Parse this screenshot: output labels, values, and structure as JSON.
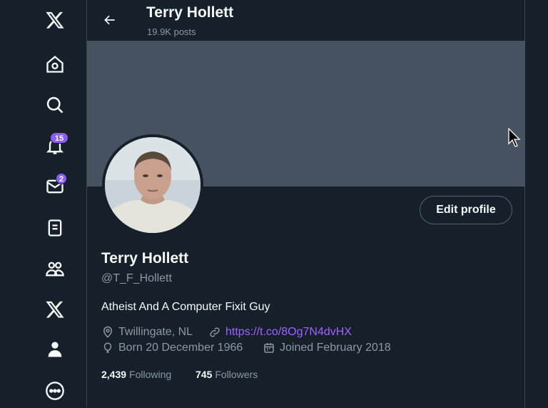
{
  "header": {
    "name": "Terry Hollett",
    "post_count": "19.9K posts"
  },
  "nav": {
    "notifications_badge": "15",
    "messages_badge": "2"
  },
  "profile": {
    "display_name": "Terry Hollett",
    "handle": "@T_F_Hollett",
    "bio": "Atheist And A Computer Fixit Guy",
    "location": "Twillingate, NL",
    "link": "https://t.co/8Og7N4dvHX",
    "birthday": "Born 20 December 1966",
    "joined": "Joined February 2018",
    "edit_label": "Edit profile",
    "following_count": "2,439",
    "following_label": "Following",
    "followers_count": "745",
    "followers_label": "Followers"
  },
  "colors": {
    "background": "#15202b",
    "banner": "#475260",
    "badge": "#8b5cf6",
    "link": "#a061ff"
  }
}
